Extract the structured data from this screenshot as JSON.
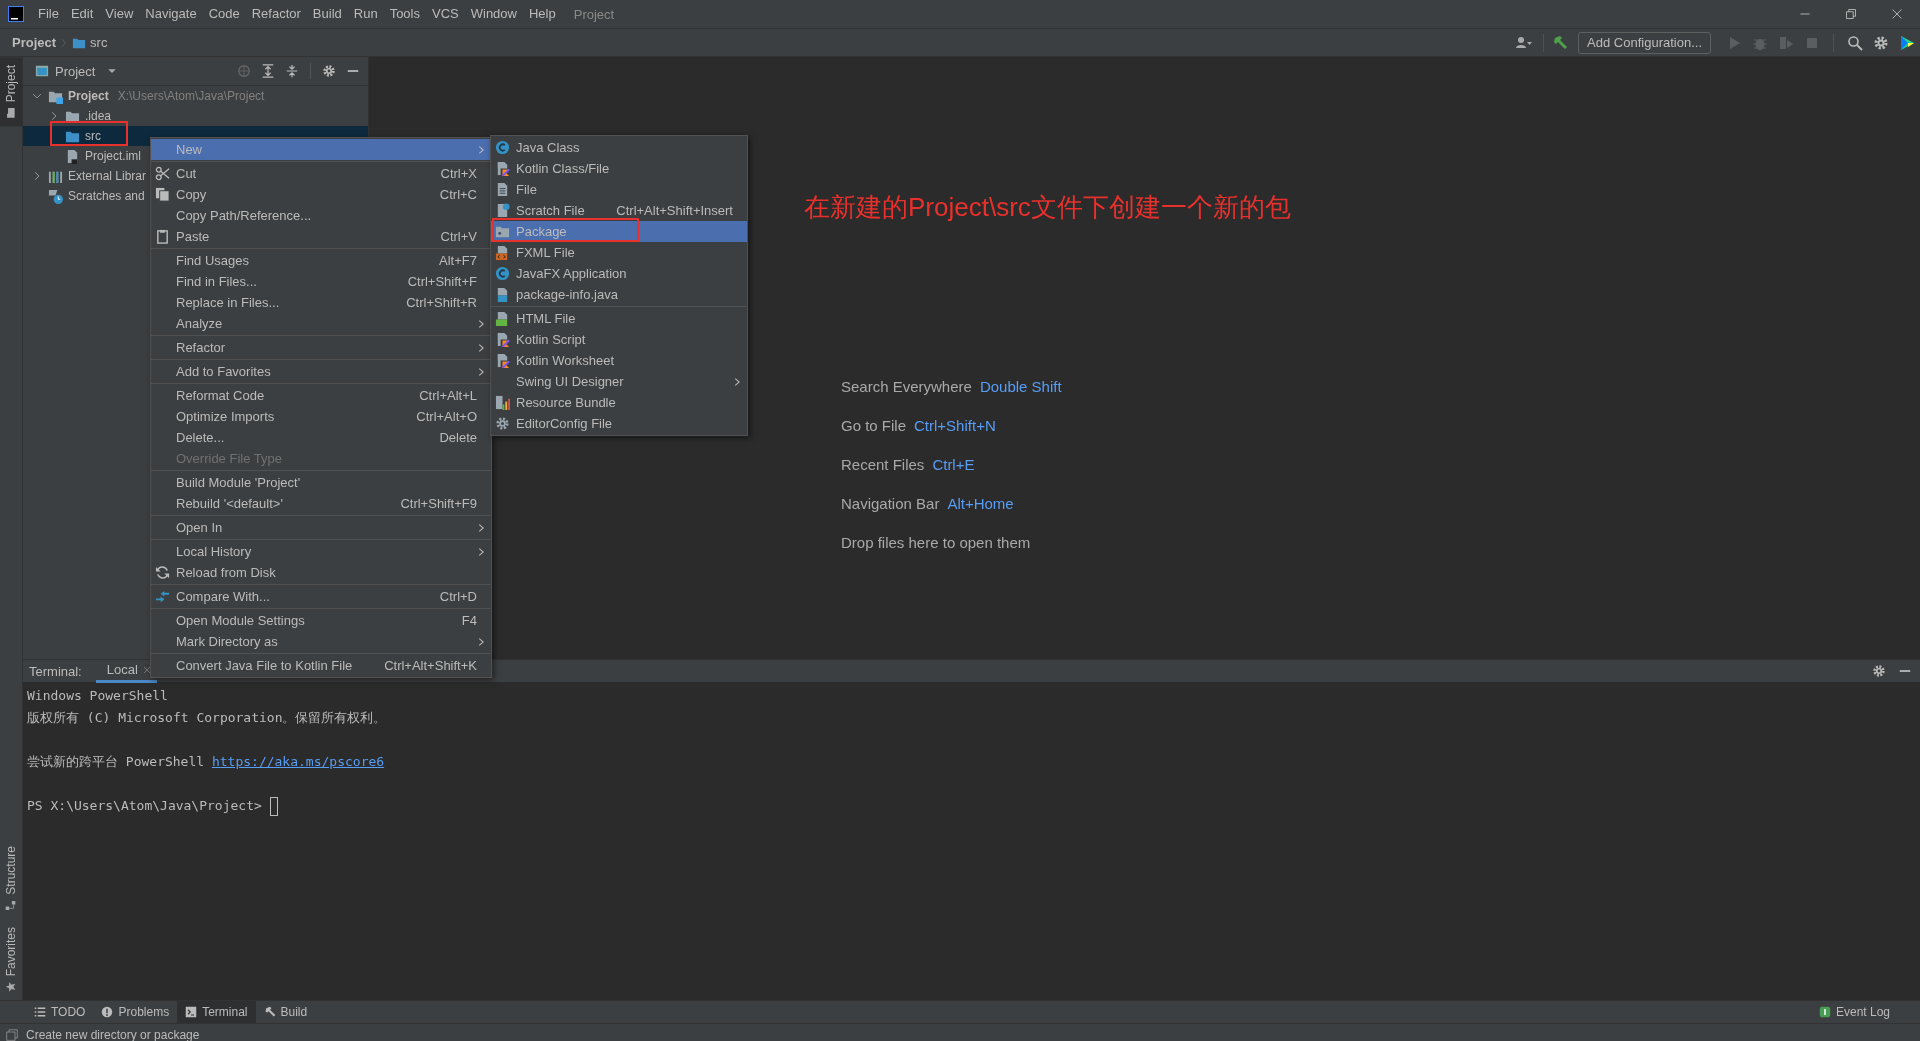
{
  "menu_bar": {
    "items": [
      "File",
      "Edit",
      "View",
      "Navigate",
      "Code",
      "Refactor",
      "Build",
      "Run",
      "Tools",
      "VCS",
      "Window",
      "Help"
    ],
    "project_title": "Project"
  },
  "breadcrumb": [
    "Project",
    "src"
  ],
  "toolbar": {
    "configuration_button": "Add Configuration...",
    "run_actions": [
      {
        "disabled": true
      },
      {
        "disabled": true
      },
      {
        "disabled": true
      },
      {
        "disabled": true
      }
    ]
  },
  "side_strip": {
    "top": [
      {
        "label": "Project",
        "selected": true
      }
    ],
    "bottom": [
      {
        "label": "Structure",
        "selected": false
      },
      {
        "label": "Favorites",
        "selected": false
      }
    ]
  },
  "project_panel": {
    "title": "Project",
    "tree": [
      {
        "label": "Project",
        "path": "X:\\Users\\Atom\\Java\\Project",
        "kind": "module",
        "expanded": true,
        "selected": false,
        "children": [
          {
            "label": ".idea",
            "kind": "folder",
            "expanded": false,
            "selected": false
          },
          {
            "label": "src",
            "kind": "source-folder",
            "selected": true
          },
          {
            "label": "Project.iml",
            "kind": "file",
            "selected": false
          }
        ]
      },
      {
        "label": "External Librar",
        "kind": "library",
        "expanded": false,
        "selected": false
      },
      {
        "label": "Scratches and",
        "kind": "scratches",
        "selected": false
      }
    ]
  },
  "annotation": "在新建的Project\\src文件下创建一个新的包",
  "editor_hints": [
    {
      "label": "Search Everywhere",
      "shortcut": "Double Shift"
    },
    {
      "label": "Go to File",
      "shortcut": "Ctrl+Shift+N"
    },
    {
      "label": "Recent Files",
      "shortcut": "Ctrl+E"
    },
    {
      "label": "Navigation Bar",
      "shortcut": "Alt+Home"
    },
    {
      "label": "Drop files here to open them"
    }
  ],
  "context_menu": {
    "groups": [
      [
        {
          "label": "New",
          "selected": true,
          "disabled": false,
          "submenu": true
        }
      ],
      [
        {
          "label": "Cut",
          "shortcut": "Ctrl+X",
          "selected": false,
          "disabled": false,
          "submenu": false
        },
        {
          "label": "Copy",
          "shortcut": "Ctrl+C",
          "selected": false,
          "disabled": false,
          "submenu": false
        },
        {
          "label": "Copy Path/Reference...",
          "selected": false,
          "disabled": false,
          "submenu": false
        },
        {
          "label": "Paste",
          "shortcut": "Ctrl+V",
          "selected": false,
          "disabled": false,
          "submenu": false
        }
      ],
      [
        {
          "label": "Find Usages",
          "shortcut": "Alt+F7",
          "selected": false,
          "disabled": false,
          "submenu": false
        },
        {
          "label": "Find in Files...",
          "shortcut": "Ctrl+Shift+F",
          "selected": false,
          "disabled": false,
          "submenu": false
        },
        {
          "label": "Replace in Files...",
          "shortcut": "Ctrl+Shift+R",
          "selected": false,
          "disabled": false,
          "submenu": false
        },
        {
          "label": "Analyze",
          "selected": false,
          "disabled": false,
          "submenu": true
        }
      ],
      [
        {
          "label": "Refactor",
          "selected": false,
          "disabled": false,
          "submenu": true
        }
      ],
      [
        {
          "label": "Add to Favorites",
          "selected": false,
          "disabled": false,
          "submenu": true
        }
      ],
      [
        {
          "label": "Reformat Code",
          "shortcut": "Ctrl+Alt+L",
          "selected": false,
          "disabled": false,
          "submenu": false
        },
        {
          "label": "Optimize Imports",
          "shortcut": "Ctrl+Alt+O",
          "selected": false,
          "disabled": false,
          "submenu": false
        },
        {
          "label": "Delete...",
          "shortcut": "Delete",
          "selected": false,
          "disabled": false,
          "submenu": false
        },
        {
          "label": "Override File Type",
          "selected": false,
          "disabled": true,
          "submenu": false
        }
      ],
      [
        {
          "label": "Build Module 'Project'",
          "selected": false,
          "disabled": false,
          "submenu": false
        },
        {
          "label": "Rebuild '<default>'",
          "shortcut": "Ctrl+Shift+F9",
          "selected": false,
          "disabled": false,
          "submenu": false
        }
      ],
      [
        {
          "label": "Open In",
          "selected": false,
          "disabled": false,
          "submenu": true
        }
      ],
      [
        {
          "label": "Local History",
          "selected": false,
          "disabled": false,
          "submenu": true
        },
        {
          "label": "Reload from Disk",
          "selected": false,
          "disabled": false,
          "submenu": false
        }
      ],
      [
        {
          "label": "Compare With...",
          "shortcut": "Ctrl+D",
          "selected": false,
          "disabled": false,
          "submenu": false
        }
      ],
      [
        {
          "label": "Open Module Settings",
          "shortcut": "F4",
          "selected": false,
          "disabled": false,
          "submenu": false
        },
        {
          "label": "Mark Directory as",
          "selected": false,
          "disabled": false,
          "submenu": true
        }
      ],
      [
        {
          "label": "Convert Java File to Kotlin File",
          "shortcut": "Ctrl+Alt+Shift+K",
          "selected": false,
          "disabled": false,
          "submenu": false
        }
      ]
    ]
  },
  "new_submenu": {
    "groups": [
      [
        {
          "label": "Java Class",
          "selected": false,
          "disabled": false,
          "submenu": false
        },
        {
          "label": "Kotlin Class/File",
          "selected": false,
          "disabled": false,
          "submenu": false
        },
        {
          "label": "File",
          "selected": false,
          "disabled": false,
          "submenu": false
        },
        {
          "label": "Scratch File",
          "shortcut": "Ctrl+Alt+Shift+Insert",
          "selected": false,
          "disabled": false,
          "submenu": false
        },
        {
          "label": "Package",
          "selected": true,
          "disabled": false,
          "submenu": false
        },
        {
          "label": "FXML File",
          "selected": false,
          "disabled": false,
          "submenu": false
        },
        {
          "label": "JavaFX Application",
          "selected": false,
          "disabled": false,
          "submenu": false
        },
        {
          "label": "package-info.java",
          "selected": false,
          "disabled": false,
          "submenu": false
        }
      ],
      [
        {
          "label": "HTML File",
          "selected": false,
          "disabled": false,
          "submenu": false
        },
        {
          "label": "Kotlin Script",
          "selected": false,
          "disabled": false,
          "submenu": false
        },
        {
          "label": "Kotlin Worksheet",
          "selected": false,
          "disabled": false,
          "submenu": false
        },
        {
          "label": "Swing UI Designer",
          "selected": false,
          "disabled": false,
          "submenu": true
        },
        {
          "label": "Resource Bundle",
          "selected": false,
          "disabled": false,
          "submenu": false
        },
        {
          "label": "EditorConfig File",
          "selected": false,
          "disabled": false,
          "submenu": false
        }
      ]
    ]
  },
  "terminal": {
    "title": "Terminal:",
    "tabs": [
      {
        "label": "Local",
        "selected": true,
        "closable": true
      }
    ],
    "blocks": [
      [
        {
          "text": "Windows PowerShell"
        },
        {
          "text": "版权所有 (C) Microsoft Corporation。保留所有权利。"
        }
      ],
      [
        {
          "text": "尝试新的跨平台 PowerShell",
          "link": "https://aka.ms/pscore6"
        }
      ],
      [
        {
          "text": "PS X:\\Users\\Atom\\Java\\Project>",
          "cursor": true
        }
      ]
    ]
  },
  "tool_windows": [
    {
      "label": "TODO",
      "selected": false
    },
    {
      "label": "Problems",
      "selected": false
    },
    {
      "label": "Terminal",
      "selected": true
    },
    {
      "label": "Build",
      "selected": false
    }
  ],
  "event_log": "Event Log",
  "status_bar": {
    "message": "Create new directory or package"
  }
}
